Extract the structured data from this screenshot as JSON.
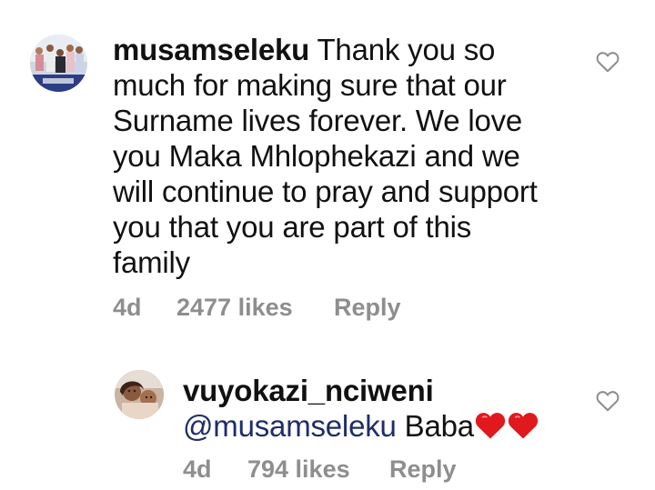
{
  "comments": [
    {
      "username": "musamseleku",
      "text": "Thank you so much for making sure that our Surname lives forever. We love you Maka Mhlophekazi and we will continue to pray and support you that you are part of this family",
      "lines": [
        "Thank you so",
        "much for making sure that our",
        "Surname lives forever. We love",
        "you Maka Mhlophekazi and we",
        "will continue to pray and support",
        "you that you are part of this",
        "family"
      ],
      "age": "4d",
      "likes": "2477 likes",
      "reply_label": "Reply",
      "avatar_icon": "group-photo-avatar"
    },
    {
      "username": "vuyokazi_nciweni",
      "mention": "@musamseleku",
      "text": "Baba",
      "emoji": "❤❤",
      "age": "4d",
      "likes": "794 likes",
      "reply_label": "Reply",
      "avatar_icon": "mother-child-avatar"
    }
  ],
  "colors": {
    "text": "#111111",
    "meta": "#8e8e8e",
    "mention": "#1f2d6a",
    "heart_emoji": "#e0191e",
    "like_icon_stroke": "#8e8e8e"
  },
  "icons": {
    "like": "heart-outline-icon",
    "emoji": "red-heart-emoji"
  }
}
